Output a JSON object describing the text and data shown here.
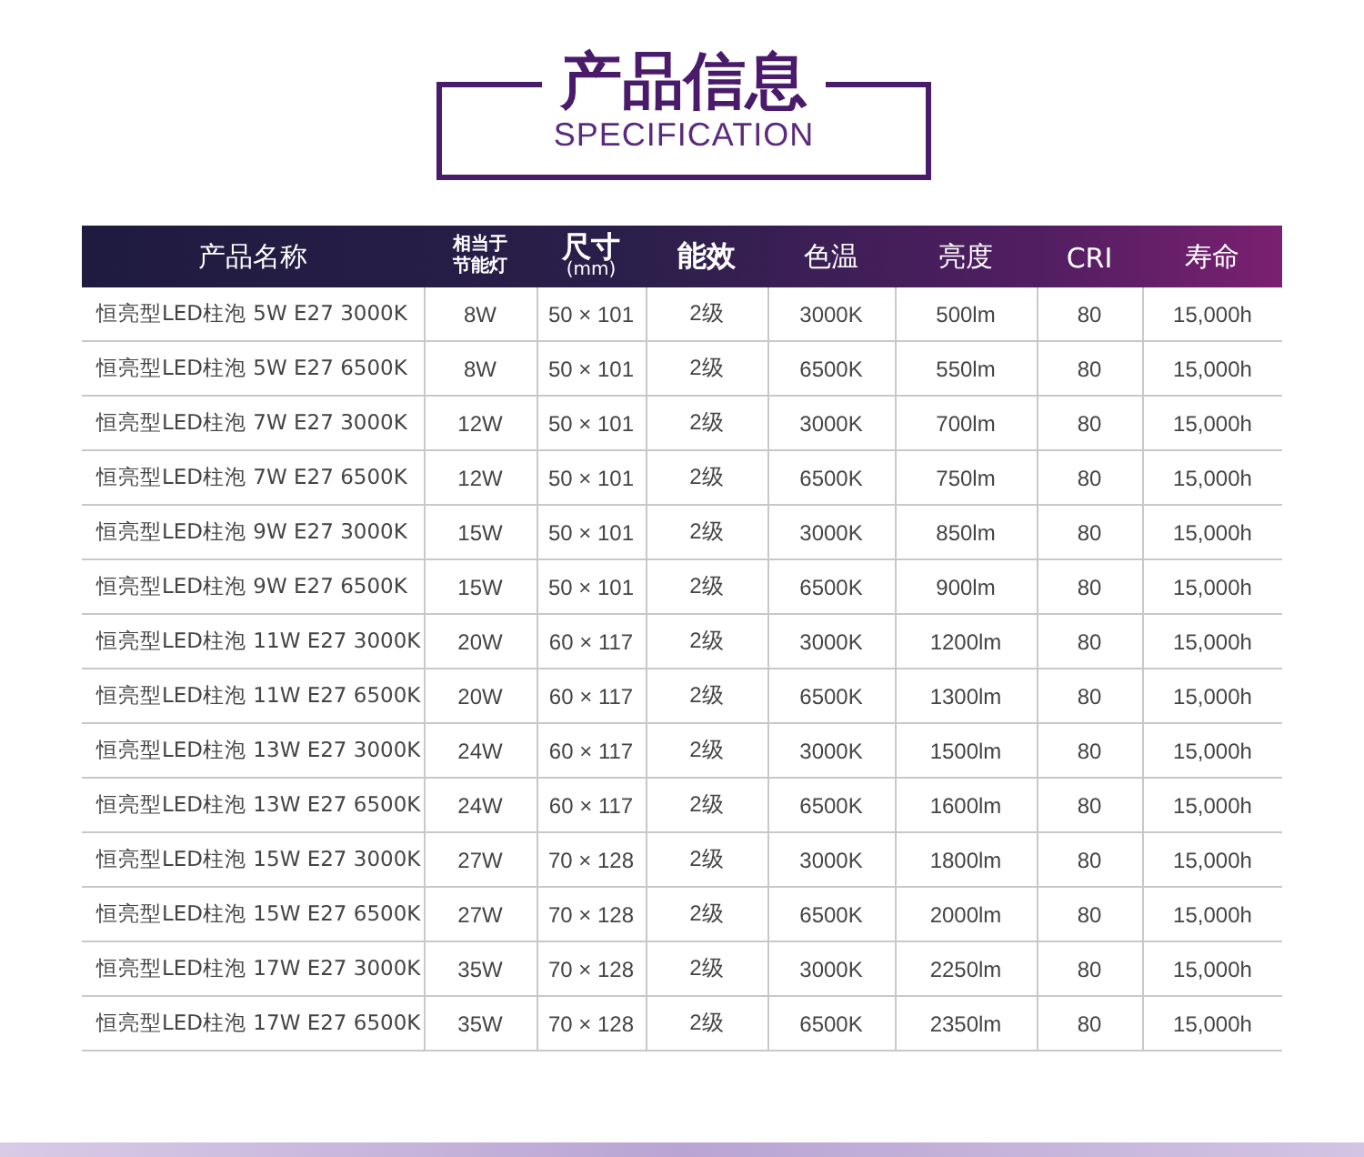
{
  "heading": {
    "title": "产品信息",
    "subtitle": "SPECIFICATION"
  },
  "table": {
    "columns": [
      {
        "label": "产品名称",
        "kind": "wide"
      },
      {
        "label": "相当于节能灯",
        "kind": "stacked"
      },
      {
        "label": "尺寸",
        "unit": "(mm)",
        "kind": "unit"
      },
      {
        "label": "能效",
        "kind": "bold"
      },
      {
        "label": "色温",
        "kind": "plain"
      },
      {
        "label": "亮度",
        "kind": "plain"
      },
      {
        "label": "CRI",
        "kind": "plain"
      },
      {
        "label": "寿命",
        "kind": "plain"
      }
    ],
    "rows": [
      [
        "恒亮型LED柱泡 5W E27 3000K",
        "8W",
        "50 × 101",
        "2级",
        "3000K",
        "500lm",
        "80",
        "15,000h"
      ],
      [
        "恒亮型LED柱泡 5W E27 6500K",
        "8W",
        "50 × 101",
        "2级",
        "6500K",
        "550lm",
        "80",
        "15,000h"
      ],
      [
        "恒亮型LED柱泡 7W E27 3000K",
        "12W",
        "50 × 101",
        "2级",
        "3000K",
        "700lm",
        "80",
        "15,000h"
      ],
      [
        "恒亮型LED柱泡 7W E27 6500K",
        "12W",
        "50 × 101",
        "2级",
        "6500K",
        "750lm",
        "80",
        "15,000h"
      ],
      [
        "恒亮型LED柱泡 9W E27 3000K",
        "15W",
        "50 × 101",
        "2级",
        "3000K",
        "850lm",
        "80",
        "15,000h"
      ],
      [
        "恒亮型LED柱泡 9W E27 6500K",
        "15W",
        "50 × 101",
        "2级",
        "6500K",
        "900lm",
        "80",
        "15,000h"
      ],
      [
        "恒亮型LED柱泡 11W E27 3000K",
        "20W",
        "60 × 117",
        "2级",
        "3000K",
        "1200lm",
        "80",
        "15,000h"
      ],
      [
        "恒亮型LED柱泡 11W E27 6500K",
        "20W",
        "60 × 117",
        "2级",
        "6500K",
        "1300lm",
        "80",
        "15,000h"
      ],
      [
        "恒亮型LED柱泡 13W E27 3000K",
        "24W",
        "60 × 117",
        "2级",
        "3000K",
        "1500lm",
        "80",
        "15,000h"
      ],
      [
        "恒亮型LED柱泡 13W E27 6500K",
        "24W",
        "60 × 117",
        "2级",
        "6500K",
        "1600lm",
        "80",
        "15,000h"
      ],
      [
        "恒亮型LED柱泡 15W E27 3000K",
        "27W",
        "70 × 128",
        "2级",
        "3000K",
        "1800lm",
        "80",
        "15,000h"
      ],
      [
        "恒亮型LED柱泡 15W E27 6500K",
        "27W",
        "70 × 128",
        "2级",
        "6500K",
        "2000lm",
        "80",
        "15,000h"
      ],
      [
        "恒亮型LED柱泡 17W E27 3000K",
        "35W",
        "70 × 128",
        "2级",
        "3000K",
        "2250lm",
        "80",
        "15,000h"
      ],
      [
        "恒亮型LED柱泡 17W E27 6500K",
        "35W",
        "70 × 128",
        "2级",
        "6500K",
        "2350lm",
        "80",
        "15,000h"
      ]
    ]
  }
}
